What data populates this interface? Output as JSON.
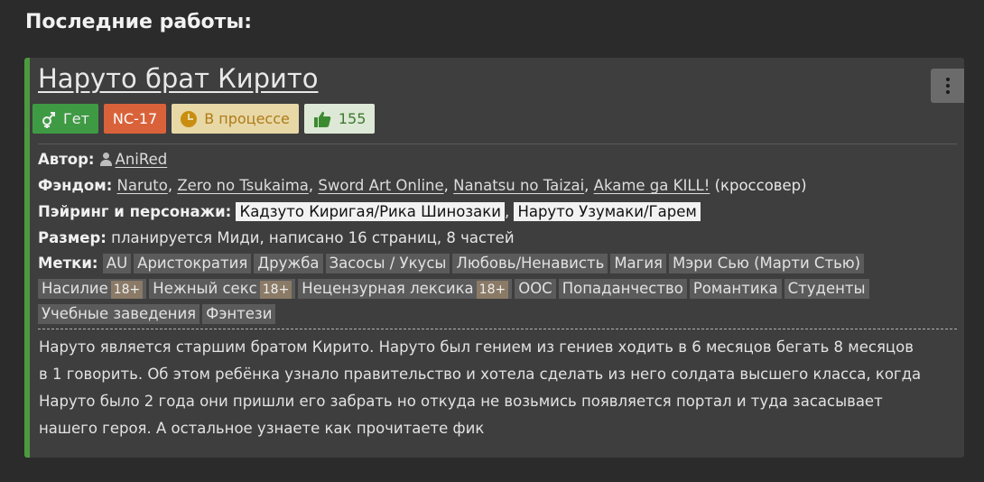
{
  "section": {
    "title": "Последние работы:"
  },
  "work": {
    "title": "Наруто брат Кирито",
    "direction": "Гет",
    "rating": "NC-17",
    "status": "В процессе",
    "likes": "155",
    "author_label": "Автор:",
    "author": "AniRed",
    "fandom_label": "Фэндом:",
    "fandoms": [
      "Naruto",
      "Zero no Tsukaima",
      "Sword Art Online",
      "Nanatsu no Taizai",
      "Akame ga KILL!"
    ],
    "fandom_suffix": "(кроссовер)",
    "pairing_label": "Пэйринг и персонажи:",
    "pairings": [
      "Кадзуто Киригая/Рика Шинозаки",
      "Наруто Узумаки/Гарем"
    ],
    "size_label": "Размер:",
    "size": "планируется Миди, написано 16 страниц, 8 частей",
    "tags_label": "Метки:",
    "tags": [
      {
        "name": "AU"
      },
      {
        "name": "Аристократия"
      },
      {
        "name": "Дружба"
      },
      {
        "name": "Засосы / Укусы"
      },
      {
        "name": "Любовь/Ненависть"
      },
      {
        "name": "Магия"
      },
      {
        "name": "Мэри Сью (Марти Стью)"
      },
      {
        "name": "Насилие",
        "adult": "18+"
      },
      {
        "name": "Нежный секс",
        "adult": "18+"
      },
      {
        "name": "Нецензурная лексика",
        "adult": "18+"
      },
      {
        "name": "ООС"
      },
      {
        "name": "Попаданчество"
      },
      {
        "name": "Романтика"
      },
      {
        "name": "Студенты"
      },
      {
        "name": "Учебные заведения"
      },
      {
        "name": "Фэнтези"
      }
    ],
    "description_lines": [
      "Наруто является старшим братом Кирито. Наруто был гением из гениев ходить в 6 месяцов бегать 8 месяцов",
      "в 1 говорить. Об этом ребёнка узнало правительство и хотела сделать из него солдата высшего класса, когда",
      "Наруто было 2 года они пришли его забрать но откуда не возьмись появляется портал и туда засасывает",
      "нашего героя. А остальное узнаете как прочитаете фик"
    ]
  },
  "icons": {
    "direction": "gender-mixed-icon",
    "status": "clock-icon",
    "likes": "thumbs-up-icon",
    "author": "person-icon",
    "menu": "more-vertical-icon"
  },
  "colors": {
    "accent": "#4c9a3f",
    "rating": "#d9623a",
    "status_bg": "#e7d8a6",
    "likes_bg": "#dde8d6"
  }
}
